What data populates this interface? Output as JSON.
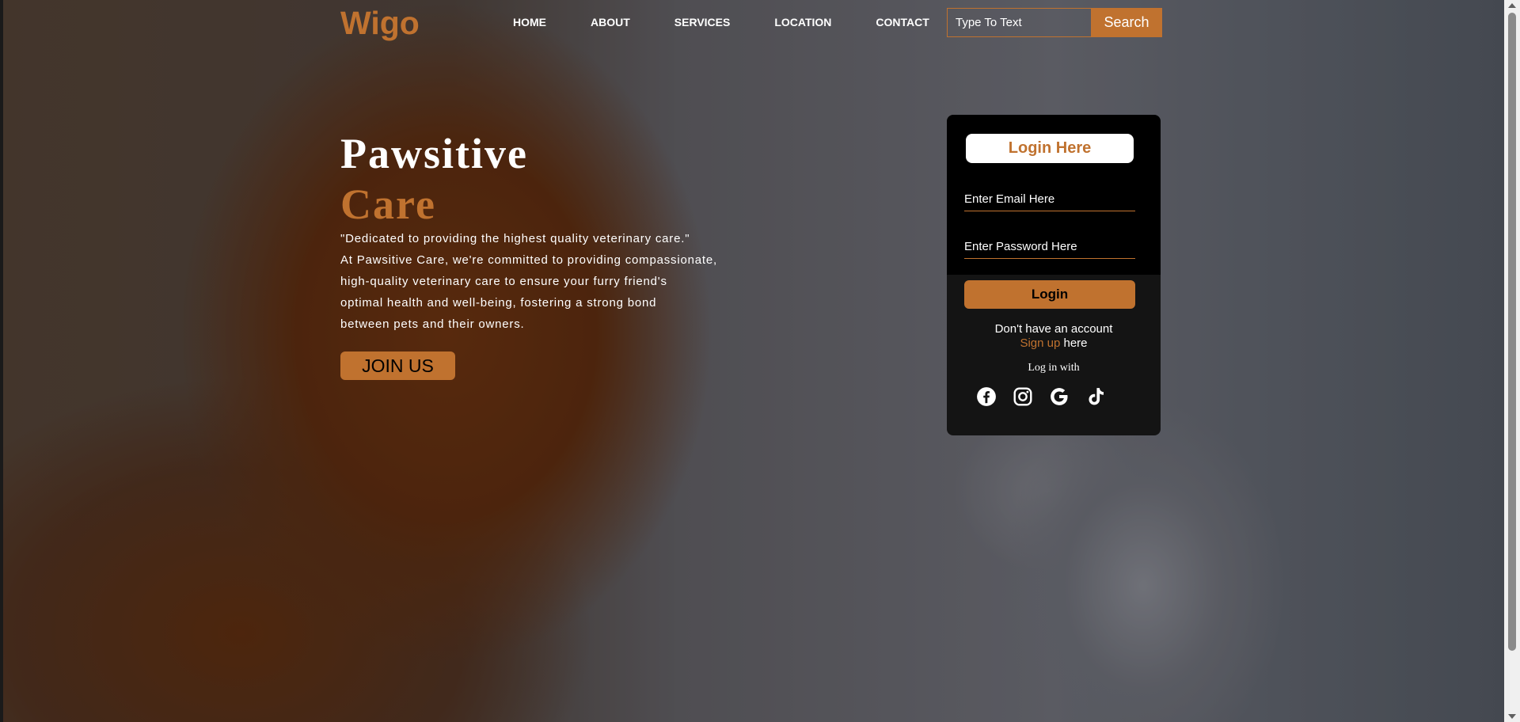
{
  "brand": {
    "logo": "Wigo",
    "accent_color": "#c0722f"
  },
  "nav": {
    "items": [
      {
        "label": "HOME"
      },
      {
        "label": "ABOUT"
      },
      {
        "label": "SERVICES"
      },
      {
        "label": "LOCATION"
      },
      {
        "label": "CONTACT"
      }
    ]
  },
  "search": {
    "placeholder": "Type To Text",
    "button_label": "Search"
  },
  "hero": {
    "title_line1": "Pawsitive",
    "title_line2": "Care",
    "tagline": "\"Dedicated to providing the highest quality veterinary care.\"",
    "body_lines": [
      "At Pawsitive Care, we're committed to providing compassionate,",
      "high-quality veterinary care to ensure your furry friend's",
      "optimal health and well-being, fostering a strong bond",
      "between pets and their owners."
    ],
    "cta_label": "JOIN US"
  },
  "login": {
    "heading": "Login Here",
    "email_placeholder": "Enter Email Here",
    "password_placeholder": "Enter Password Here",
    "button_label": "Login",
    "no_account_text": "Don't have an account",
    "signup_link": "Sign up",
    "signup_suffix": " here",
    "login_with_text": "Log in with",
    "social_icons": [
      "facebook-icon",
      "instagram-icon",
      "google-icon",
      "tiktok-icon"
    ]
  }
}
